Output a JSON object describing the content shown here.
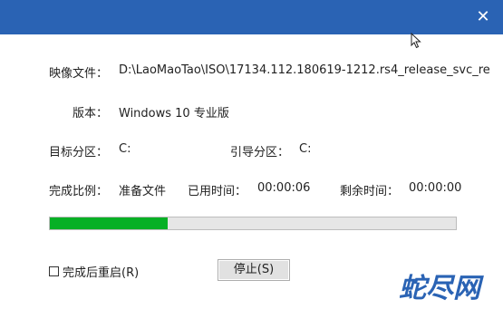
{
  "titlebar": {
    "close_glyph": "✕",
    "color": "#2a63b4"
  },
  "rows": {
    "image_label": "映像文件：",
    "image_value": "D:\\LaoMaoTao\\ISO\\17134.112.180619-1212.rs4_release_svc_re",
    "version_label": "版本：",
    "version_value": "Windows 10 专业版",
    "target_label": "目标分区：",
    "target_value": "C:",
    "boot_label": "引导分区：",
    "boot_value": "C:",
    "ratio_label": "完成比例：",
    "ratio_value": "准备文件",
    "elapsed_label": "已用时间：",
    "elapsed_value": "00:00:06",
    "remaining_label": "剩余时间：",
    "remaining_value": "00:00:00"
  },
  "progress": {
    "fraction": 0.29,
    "fill_color": "#06b025"
  },
  "restart_checkbox": {
    "label": "完成后重启(R)",
    "checked": false
  },
  "stop_button": {
    "label": "停止(S)"
  },
  "watermark": {
    "text": "蛇尽网",
    "color": "#2a63b4"
  },
  "cursor_icon": "mouse-pointer-icon"
}
